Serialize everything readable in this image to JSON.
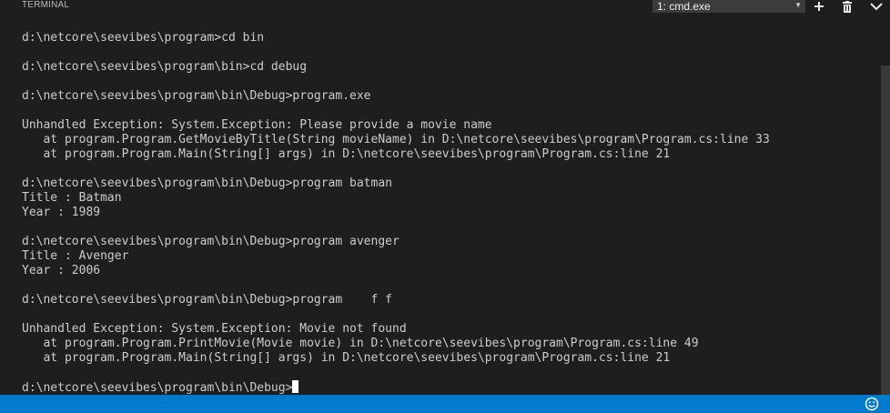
{
  "panel": {
    "title": "TERMINAL"
  },
  "terminal_select": {
    "value": "1: cmd.exe"
  },
  "header_icons": [
    "plus-icon",
    "trash-icon",
    "chevron-down-icon"
  ],
  "terminal": {
    "lines": [
      "d:\\netcore\\seevibes\\program>cd bin",
      "",
      "d:\\netcore\\seevibes\\program\\bin>cd debug",
      "",
      "d:\\netcore\\seevibes\\program\\bin\\Debug>program.exe",
      "",
      "Unhandled Exception: System.Exception: Please provide a movie name",
      "   at program.Program.GetMovieByTitle(String movieName) in D:\\netcore\\seevibes\\program\\Program.cs:line 33",
      "   at program.Program.Main(String[] args) in D:\\netcore\\seevibes\\program\\Program.cs:line 21",
      "",
      "d:\\netcore\\seevibes\\program\\bin\\Debug>program batman",
      "Title : Batman",
      "Year : 1989",
      "",
      "d:\\netcore\\seevibes\\program\\bin\\Debug>program avenger",
      "Title : Avenger",
      "Year : 2006",
      "",
      "d:\\netcore\\seevibes\\program\\bin\\Debug>program    f f",
      "",
      "Unhandled Exception: System.Exception: Movie not found",
      "   at program.Program.PrintMovie(Movie movie) in D:\\netcore\\seevibes\\program\\Program.cs:line 49",
      "   at program.Program.Main(String[] args) in D:\\netcore\\seevibes\\program\\Program.cs:line 21",
      ""
    ],
    "prompt": "d:\\netcore\\seevibes\\program\\bin\\Debug>"
  },
  "status_bar": {
    "icon": "smiley-icon",
    "color": "#007acc"
  }
}
